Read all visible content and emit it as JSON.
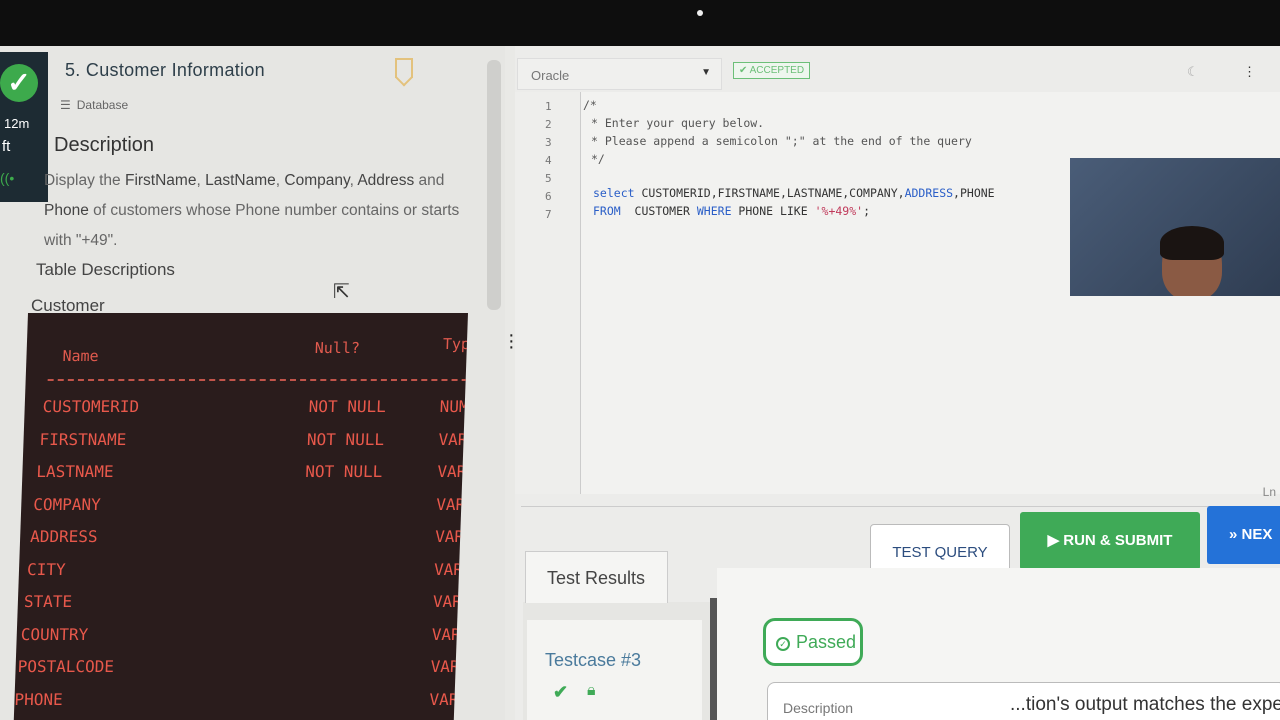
{
  "nav": {
    "timer": "12m",
    "left_text": "ft"
  },
  "question": {
    "title": "5. Customer Information",
    "category": "Database",
    "description_heading": "Description",
    "description_parts": {
      "p1": "Display the ",
      "b1": "FirstName",
      "p2": ", ",
      "b2": "LastName",
      "p3": ", ",
      "b3": "Company",
      "p4": ", ",
      "b4": "Address",
      "p5": " and ",
      "b5": "Phone",
      "p6": " of customers whose Phone number contains or starts with \"+49\"."
    },
    "table_descriptions_heading": "Table Descriptions",
    "table_name": "Customer"
  },
  "schema": {
    "headers": {
      "name": "Name",
      "null": "Null?",
      "type": "Typ"
    },
    "rows": [
      {
        "name": "CUSTOMERID",
        "null": "NOT NULL",
        "type": "NUM"
      },
      {
        "name": "FIRSTNAME",
        "null": "NOT NULL",
        "type": "VAR"
      },
      {
        "name": "LASTNAME",
        "null": "NOT NULL",
        "type": "VAR"
      },
      {
        "name": "COMPANY",
        "null": "",
        "type": "VAR"
      },
      {
        "name": "ADDRESS",
        "null": "",
        "type": "VAR"
      },
      {
        "name": "CITY",
        "null": "",
        "type": "VAR"
      },
      {
        "name": "STATE",
        "null": "",
        "type": "VAR"
      },
      {
        "name": "COUNTRY",
        "null": "",
        "type": "VAR"
      },
      {
        "name": "POSTALCODE",
        "null": "",
        "type": "VAR"
      },
      {
        "name": "PHONE",
        "null": "",
        "type": "VAR"
      }
    ]
  },
  "editor": {
    "database": "Oracle",
    "status_badge": "ACCEPTED",
    "line_numbers": [
      "1",
      "2",
      "3",
      "4",
      "5",
      "6",
      "7"
    ],
    "code": {
      "l1": "/*",
      "l2": "* Enter your query below.",
      "l3": "* Please append a semicolon \";\" at the end of the query",
      "l4": "*/",
      "l6_kw": "select",
      "l6_rest": " CUSTOMERID,FIRSTNAME,LASTNAME,COMPANY,",
      "l6_kw2": "ADDRESS",
      "l6_rest2": ",PHONE",
      "l7_kw": "FROM",
      "l7_rest": "  CUSTOMER ",
      "l7_kw2": "WHERE",
      "l7_rest2": " PHONE LIKE ",
      "l7_str": "'%+49%'",
      "l7_end": ";"
    },
    "cursor_pos": "Ln"
  },
  "actions": {
    "test_query": "TEST QUERY",
    "run_submit": "RUN & SUBMIT",
    "next": "NEX"
  },
  "results": {
    "tab_label": "Test Results",
    "testcase_name": "Testcase #3",
    "status": "Passed",
    "description_label": "Description",
    "description_text": "...tion's output matches the expec"
  }
}
